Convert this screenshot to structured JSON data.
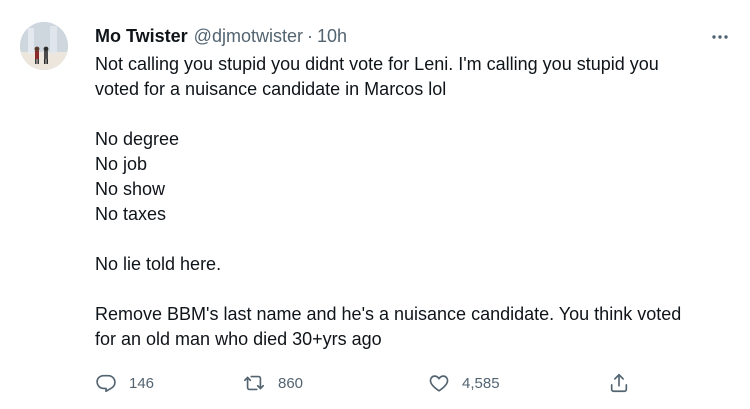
{
  "tweet": {
    "author_name": "Mo Twister",
    "author_handle": "@djmotwister",
    "separator": "·",
    "timestamp": "10h",
    "lines": [
      "Not calling you stupid you didnt vote for Leni. I'm calling you stupid you",
      "voted for a nuisance candidate in Marcos lol",
      "",
      "No degree",
      "No job",
      "No show",
      "No taxes",
      "",
      "No lie told here.",
      "",
      "Remove BBM's last name and he's a nuisance candidate. You think voted",
      "for an old man who died 30+yrs ago"
    ]
  },
  "actions": {
    "reply_count": "146",
    "retweet_count": "860",
    "like_count": "4,585"
  },
  "icons": {
    "more": "more-horizontal-icon",
    "reply": "reply-icon",
    "retweet": "retweet-icon",
    "like": "heart-icon",
    "share": "share-icon"
  },
  "colors": {
    "text": "#0f1419",
    "secondary": "#536471"
  }
}
